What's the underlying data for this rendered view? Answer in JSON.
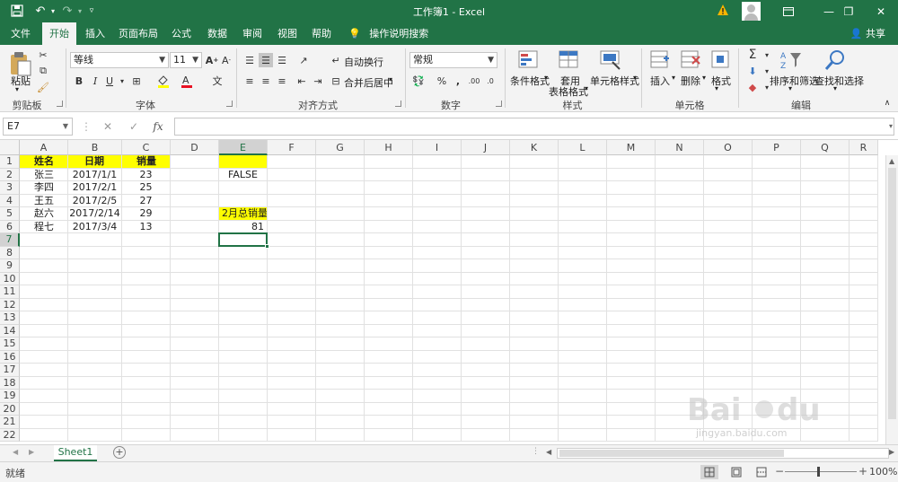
{
  "window": {
    "title": "工作簿1  -  Excel",
    "restore_icon": "restore-icon",
    "minimize_icon": "minimize-icon",
    "close_icon": "close-icon"
  },
  "menu_tabs": [
    "文件",
    "开始",
    "插入",
    "页面布局",
    "公式",
    "数据",
    "审阅",
    "视图",
    "帮助"
  ],
  "active_tab": "开始",
  "tell_me": "操作说明搜索",
  "share": "共享",
  "ribbon": {
    "clipboard": {
      "label": "剪贴板",
      "paste": "粘贴"
    },
    "font": {
      "label": "字体",
      "font_name": "等线",
      "font_size": "11",
      "bold": "B",
      "italic": "I",
      "underline": "U"
    },
    "alignment": {
      "label": "对齐方式",
      "wrap_text": "自动换行",
      "merge_center": "合并后居中"
    },
    "number": {
      "label": "数字",
      "format": "常规",
      "percent": "%",
      "comma": ","
    },
    "styles": {
      "label": "样式",
      "conditional": "条件格式",
      "table_format_1": "套用",
      "table_format_2": "表格格式",
      "cell_styles": "单元格样式"
    },
    "cells": {
      "label": "单元格",
      "insert": "插入",
      "delete": "删除",
      "format": "格式"
    },
    "editing": {
      "label": "编辑",
      "sort_filter": "排序和筛选",
      "find_select": "查找和选择",
      "sum_symbol": "Σ"
    }
  },
  "formula_bar": {
    "name_box": "E7",
    "fx": "fx",
    "cancel": "✕",
    "enter": "✓",
    "value": ""
  },
  "columns": [
    "A",
    "B",
    "C",
    "D",
    "E",
    "F",
    "G",
    "H",
    "I",
    "J",
    "K",
    "L",
    "M",
    "N",
    "O",
    "P",
    "Q",
    "R"
  ],
  "rows": [
    "1",
    "2",
    "3",
    "4",
    "5",
    "6",
    "7",
    "8",
    "9",
    "10",
    "11",
    "12",
    "13",
    "14",
    "15",
    "16",
    "17",
    "18",
    "19",
    "20",
    "21",
    "22"
  ],
  "cells": {
    "A1": "姓名",
    "B1": "日期",
    "C1": "销量",
    "A2": "张三",
    "B2": "2017/1/1",
    "C2": "23",
    "A3": "李四",
    "B3": "2017/2/1",
    "C3": "25",
    "A4": "王五",
    "B4": "2017/2/5",
    "C4": "27",
    "A5": "赵六",
    "B5": "2017/2/14",
    "C5": "29",
    "A6": "程七",
    "B6": "2017/3/4",
    "C6": "13",
    "E2": "FALSE",
    "E5": "2月总销量",
    "E6": "81"
  },
  "highlight_color": "#ffff00",
  "accent_color": "#217346",
  "sheet_tab": "Sheet1",
  "status": {
    "ready": "就绪",
    "zoom": "100%"
  }
}
